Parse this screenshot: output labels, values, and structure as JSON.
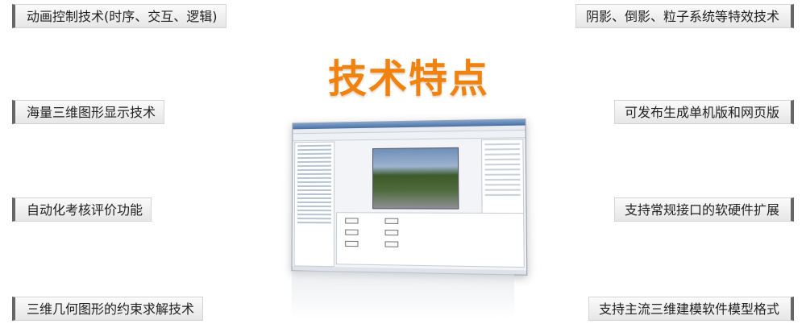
{
  "title": "技术特点",
  "left_features": [
    "动画控制技术(时序、交互、逻辑)",
    "海量三维图形显示技术",
    "自动化考核评价功能",
    "三维几何图形的约束求解技术"
  ],
  "right_features": [
    "阴影、倒影、粒子系统等特效技术",
    "可发布生成单机版和网页版",
    "支持常规接口的软硬件扩展",
    "支持主流三维建模软件模型格式"
  ]
}
